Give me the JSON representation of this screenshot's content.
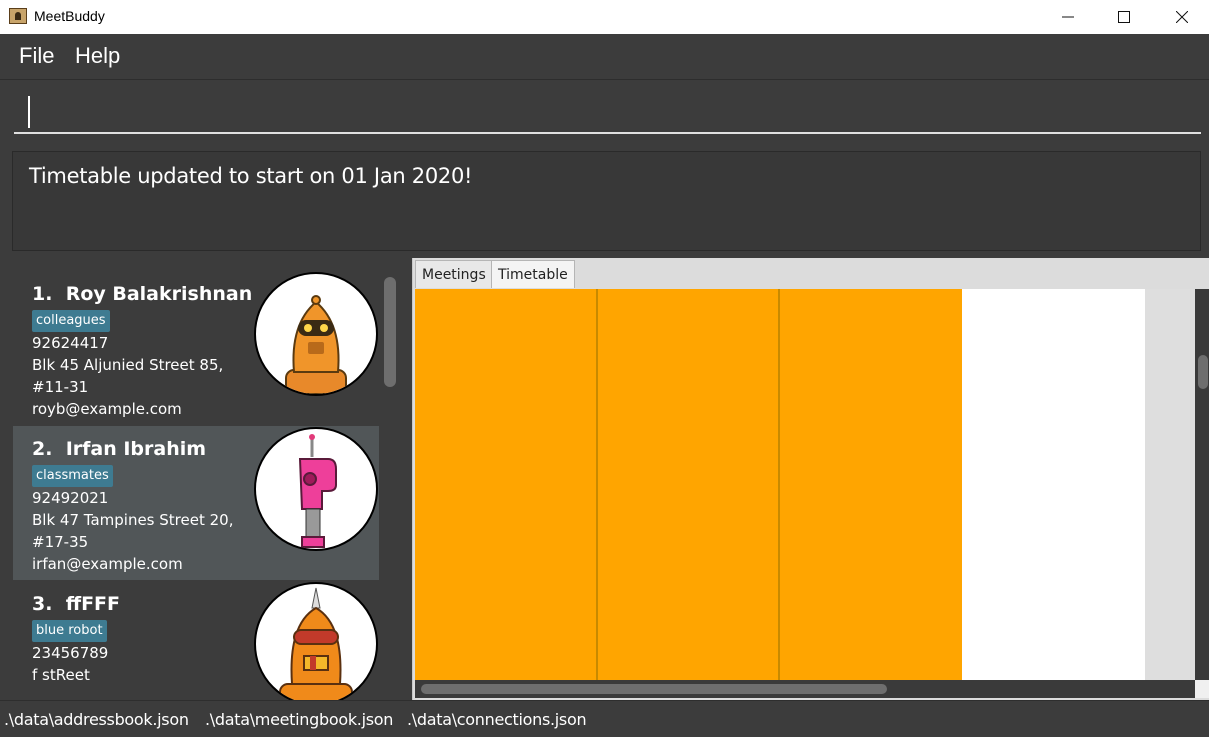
{
  "window": {
    "title": "MeetBuddy",
    "minimize": "—",
    "maximize": "☐",
    "close": "✕"
  },
  "menu": {
    "items": [
      "File",
      "Help"
    ]
  },
  "command_box": {
    "value": "",
    "placeholder": ""
  },
  "result_display": {
    "text": "Timetable updated to start on 01 Jan 2020!"
  },
  "persons": [
    {
      "index": "1.",
      "name": "Roy Balakrishnan",
      "tag": "colleagues",
      "phone": "92624417",
      "address_line1": "Blk 45 Aljunied Street 85,",
      "address_line2": "#11-31",
      "email": "royb@example.com",
      "avatar": "orange-robot-avatar"
    },
    {
      "index": "2.",
      "name": "Irfan Ibrahim",
      "tag": "classmates",
      "phone": "92492021",
      "address_line1": "Blk 47 Tampines Street 20,",
      "address_line2": "#17-35",
      "email": "irfan@example.com",
      "avatar": "pink-robot-avatar"
    },
    {
      "index": "3.",
      "name": "ffFFF",
      "tag": "blue robot",
      "phone": "23456789",
      "address_line1": "f stReet",
      "address_line2": "",
      "email": "",
      "avatar": "orange-drill-robot-avatar"
    }
  ],
  "tabs": {
    "items": [
      "Meetings",
      "Timetable"
    ],
    "active": "Timetable"
  },
  "timetable": {
    "filled_color": "#ffa500",
    "filled_columns": 3,
    "empty_columns": 1
  },
  "status_bar": {
    "items": [
      ".\\data\\addressbook.json",
      ".\\data\\meetingbook.json",
      ".\\data\\connections.json"
    ]
  },
  "colors": {
    "background": "#3c3c3c",
    "selected_card": "#515658",
    "tag": "#3e7b91",
    "timetable_slot": "#ffa500"
  }
}
